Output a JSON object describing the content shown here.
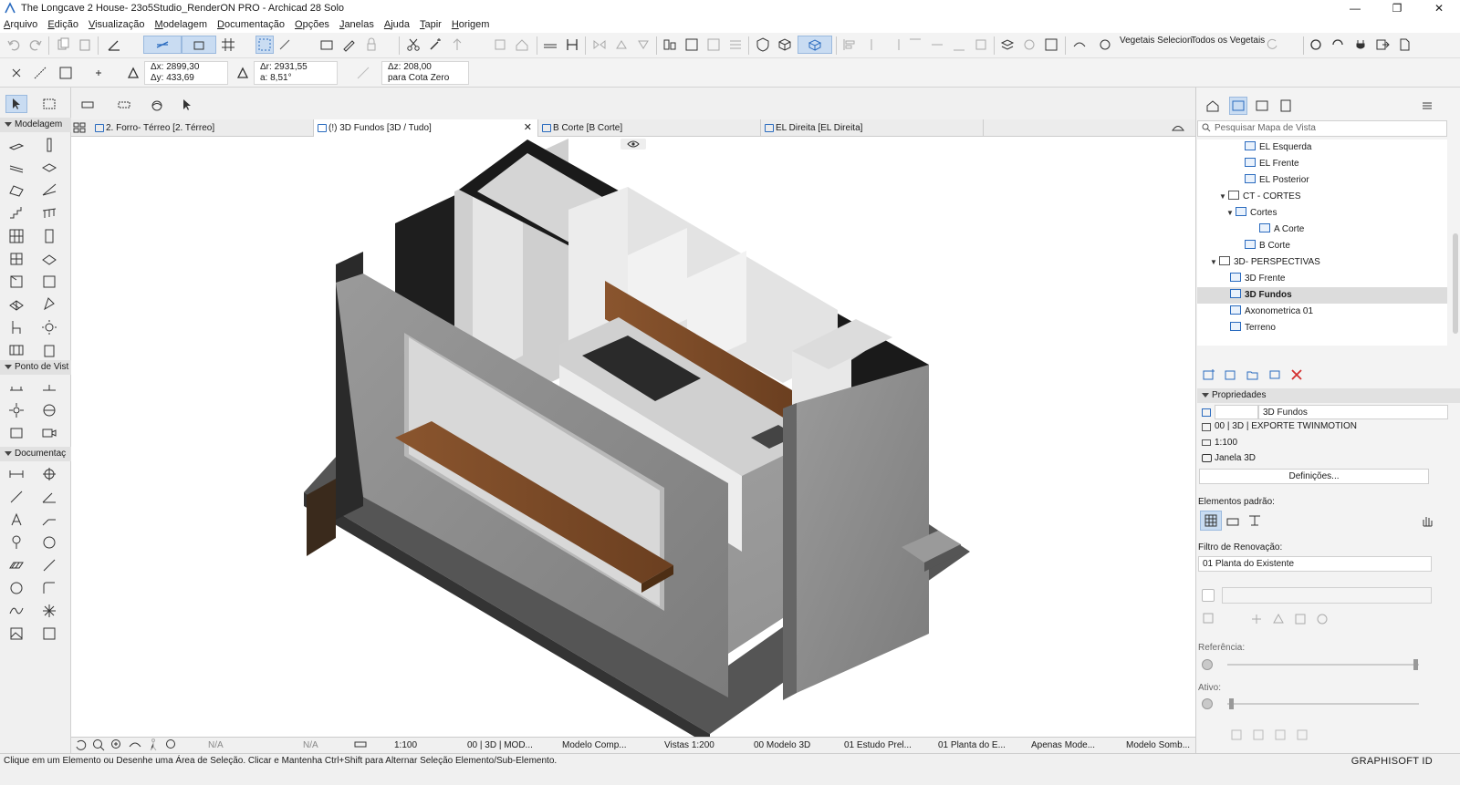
{
  "window": {
    "title": "The Longcave 2 House- 23o5Studio_RenderON PRO - Archicad 28 Solo",
    "minimize": "—",
    "maximize": "❐",
    "close": "✕"
  },
  "menu": [
    "Arquivo",
    "Edição",
    "Visualização",
    "Modelagem",
    "Documentação",
    "Opções",
    "Janelas",
    "Ajuda",
    "Tapir",
    "Horigem"
  ],
  "toolbar": {
    "veg_selecionados": "Vegetais Selecion",
    "todos_vegetais": "Todos os Vegetais"
  },
  "coords": {
    "dx": "Δx: 2899,30",
    "dy": "Δy: 433,69",
    "dr": "Δr: 2931,55",
    "a": "a: 8,51°",
    "dz": "Δz: 208,00",
    "cota": "para Cota Zero"
  },
  "left_sections": {
    "modelagem": "Modelagem",
    "ponto_vista": "Ponto de Vist",
    "documentacao": "Documentaç"
  },
  "tabs": [
    {
      "label": "2. Forro- Térreo [2. Térreo]"
    },
    {
      "label": "(!) 3D Fundos [3D / Tudo]",
      "close": "✕"
    },
    {
      "label": "B Corte [B Corte]"
    },
    {
      "label": "EL Direita [EL Direita]"
    }
  ],
  "bottombar": {
    "na1": "N/A",
    "na2": "N/A",
    "scale": "1:100",
    "layer": "00 | 3D | MOD...",
    "model": "Modelo Comp...",
    "views": "Vistas 1:200",
    "model3d": "00 Modelo 3D",
    "estudo": "01 Estudo Prel...",
    "planta": "01 Planta do E...",
    "apenas": "Apenas Mode...",
    "sombra": "Modelo Somb..."
  },
  "status": {
    "message": "Clique em um Elemento ou Desenhe uma Área de Seleção. Clicar e Mantenha Ctrl+Shift para Alternar Seleção Elemento/Sub-Elemento.",
    "brand": "GRAPHISOFT ID"
  },
  "navigator": {
    "search_placeholder": "Pesquisar Mapa de Vista",
    "items": [
      {
        "label": "EL Esquerda"
      },
      {
        "label": "EL Frente"
      },
      {
        "label": "EL Posterior"
      },
      {
        "label": "CT - CORTES"
      },
      {
        "label": "Cortes"
      },
      {
        "label": "A Corte"
      },
      {
        "label": "B Corte"
      },
      {
        "label": "3D- PERSPECTIVAS"
      },
      {
        "label": "3D Frente"
      },
      {
        "label": "3D Fundos"
      },
      {
        "label": "Axonometrica 01"
      },
      {
        "label": "Terreno"
      }
    ]
  },
  "properties": {
    "header": "Propriedades",
    "name": "3D Fundos",
    "layer": "00 | 3D | EXPORTE TWINMOTION",
    "scale": "1:100",
    "window": "Janela 3D",
    "settings_button": "Definições...",
    "default_elements": "Elementos padrão:",
    "renovation_filter": "Filtro de Renovação:",
    "renovation_value": "01 Planta do Existente",
    "referencia": "Referência:",
    "ativo": "Ativo:"
  },
  "colors": {
    "accent": "#2a6bbf",
    "selected_tab": "#ffffff",
    "concrete": "#8a8a8a",
    "wood": "#7a4a2a"
  }
}
